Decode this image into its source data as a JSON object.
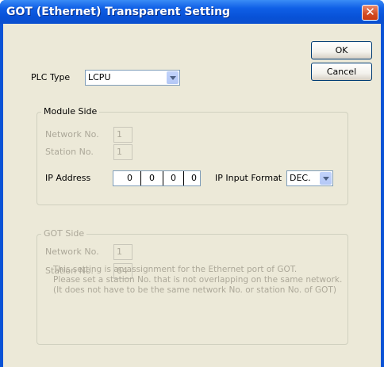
{
  "window": {
    "title": "GOT (Ethernet) Transparent Setting",
    "close_glyph": "✕"
  },
  "buttons": {
    "ok_label": "OK",
    "cancel_label": "Cancel"
  },
  "plc": {
    "label": "PLC Type",
    "value": "LCPU"
  },
  "module_side": {
    "legend": "Module Side",
    "network_label": "Network No.",
    "network_value": "1",
    "station_label": "Station No.",
    "station_value": "1",
    "ip_label": "IP Address",
    "ip_octets": [
      "0",
      "0",
      "0",
      "0"
    ],
    "ip_format_label": "IP Input Format",
    "ip_format_value": "DEC."
  },
  "got_side": {
    "legend": "GOT Side",
    "network_label": "Network No.",
    "network_value": "1",
    "station_label": "Station No.",
    "station_value": "64",
    "note_lines": [
      "This setting is an assignment for the Ethernet port of GOT.",
      "Please set a station No. that is not overlapping on the same network.",
      "(It does not have to be the same network No. or station No. of GOT)"
    ]
  },
  "colors": {
    "title_bar": "#0a53d6",
    "client_bg": "#ece9d8",
    "close_button": "#d24a21",
    "disabled_text": "#aca899"
  }
}
